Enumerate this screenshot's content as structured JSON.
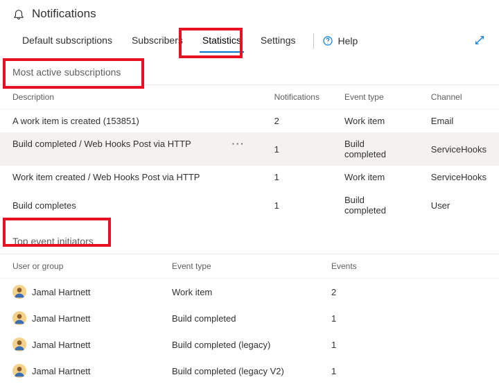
{
  "page": {
    "title": "Notifications"
  },
  "tabs": {
    "default_subscriptions": "Default subscriptions",
    "subscribers": "Subscribers",
    "statistics": "Statistics",
    "settings": "Settings"
  },
  "help_label": "Help",
  "sections": {
    "most_active": "Most active subscriptions",
    "top_initiators": "Top event initiators"
  },
  "subs_table": {
    "headers": {
      "description": "Description",
      "notifications": "Notifications",
      "event_type": "Event type",
      "channel": "Channel"
    },
    "rows": [
      {
        "description": "A work item is created (153851)",
        "notifications": "2",
        "event_type": "Work item",
        "channel": "Email",
        "hover": false
      },
      {
        "description": "Build completed / Web Hooks Post via HTTP",
        "notifications": "1",
        "event_type": "Build completed",
        "channel": "ServiceHooks",
        "hover": true
      },
      {
        "description": "Work item created / Web Hooks Post via HTTP",
        "notifications": "1",
        "event_type": "Work item",
        "channel": "ServiceHooks",
        "hover": false
      },
      {
        "description": "Build completes",
        "notifications": "1",
        "event_type": "Build completed",
        "channel": "User",
        "hover": false
      }
    ]
  },
  "init_table": {
    "headers": {
      "user": "User or group",
      "event_type": "Event type",
      "events": "Events"
    },
    "rows": [
      {
        "user": "Jamal Hartnett",
        "event_type": "Work item",
        "events": "2"
      },
      {
        "user": "Jamal Hartnett",
        "event_type": "Build completed",
        "events": "1"
      },
      {
        "user": "Jamal Hartnett",
        "event_type": "Build completed (legacy)",
        "events": "1"
      },
      {
        "user": "Jamal Hartnett",
        "event_type": "Build completed (legacy V2)",
        "events": "1"
      }
    ]
  }
}
